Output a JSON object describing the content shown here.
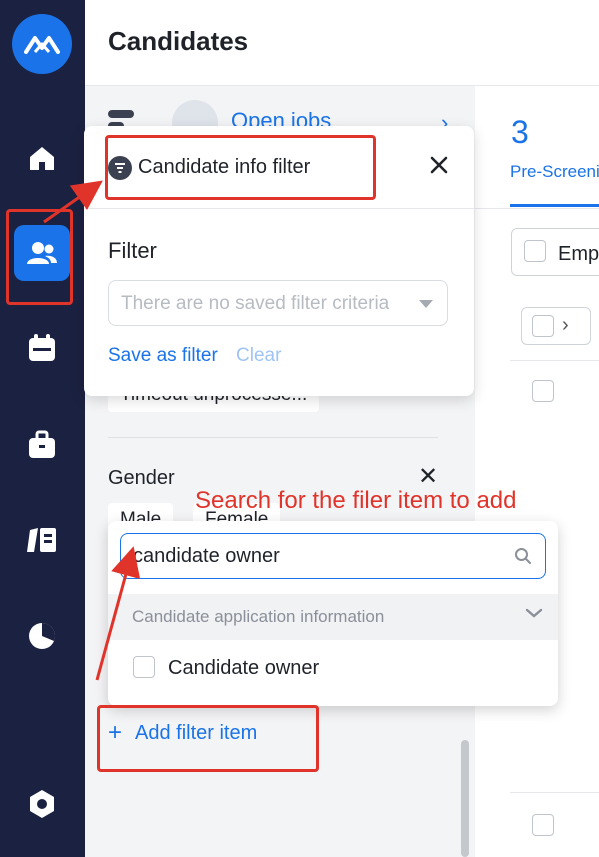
{
  "header": {
    "title": "Candidates"
  },
  "nav": {
    "items": [
      "home-icon",
      "users-icon",
      "calendar-icon",
      "briefcase-icon",
      "book-icon",
      "pie-chart-icon",
      "settings-icon"
    ],
    "active": "users-icon"
  },
  "side_panel": {
    "open_jobs": "Open jobs",
    "timeout_chip": "Timeout unprocesse...",
    "gender_title": "Gender",
    "gender_options": [
      "Male",
      "Female"
    ]
  },
  "right_panel": {
    "count": "3",
    "stage": "Pre-Screening",
    "column_label": "Emp"
  },
  "filter_popup": {
    "title": "Candidate info filter",
    "filter_label": "Filter",
    "select_placeholder": "There are no saved filter criteria",
    "save_label": "Save as filter",
    "clear_label": "Clear"
  },
  "annotation": {
    "text": "Search for the filer item to add",
    "color": "#e0342b"
  },
  "search_dropdown": {
    "input_value": "candidate owner",
    "group_label": "Candidate application information",
    "option_label": "Candidate owner"
  },
  "add_filter_label": "Add filter item",
  "colors": {
    "accent": "#1a73e8",
    "rail": "#1b2140",
    "annotation": "#e0342b"
  }
}
